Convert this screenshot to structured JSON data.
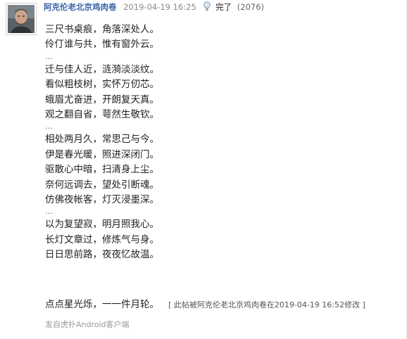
{
  "post": {
    "author": "阿克伦老北京鸡肉卷",
    "timestamp": "2019-04-19 16:25",
    "view_label": "完了",
    "view_count": "(2076)",
    "icons": {
      "avatar": "avatar",
      "view": "lightbulb-icon"
    }
  },
  "content": {
    "lines": [
      "三尺书桌痕，角落深处人。",
      "伶仃谁与共，惟有窗外云。",
      "…",
      "迁与佳人近，涟漪淡淡纹。",
      "看似粗枝树，实怀万仞芯。",
      "蛾眉尤奋进，开朗复天真。",
      "观之翻自省，萼然生敬钦。",
      "…",
      "相处两月久，常思己与今。",
      "伊是春光暖，照进深闭门。",
      "驱散心中暗，扫清身上尘。",
      "奈何远调去，望处引断魂。",
      "仿佛夜帐客，灯灭浸墨深。",
      "…",
      "以为复望寂，明月照我心。",
      "长灯文章过，修炼气与身。",
      "日日思前路，夜夜忆故温。"
    ],
    "closing": "点点星光烁，一一件月轮。",
    "edit_note": "[ 此帖被阿克伦老北京鸡肉卷在2019-04-19 16:52修改 ]"
  },
  "footer": {
    "client": "发自虎扑Android客户端"
  }
}
